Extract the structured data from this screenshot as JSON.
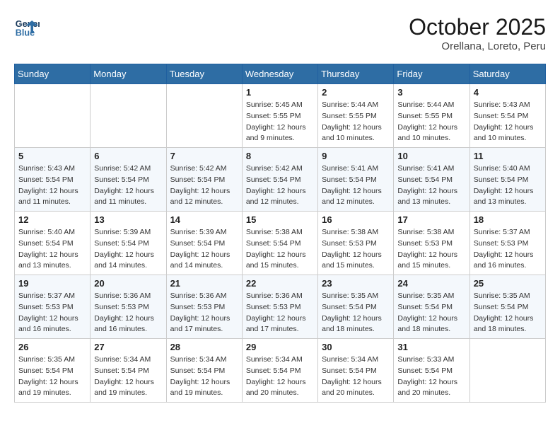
{
  "header": {
    "logo_line1": "General",
    "logo_line2": "Blue",
    "month": "October 2025",
    "location": "Orellana, Loreto, Peru"
  },
  "days_of_week": [
    "Sunday",
    "Monday",
    "Tuesday",
    "Wednesday",
    "Thursday",
    "Friday",
    "Saturday"
  ],
  "weeks": [
    [
      {
        "day": "",
        "info": ""
      },
      {
        "day": "",
        "info": ""
      },
      {
        "day": "",
        "info": ""
      },
      {
        "day": "1",
        "info": "Sunrise: 5:45 AM\nSunset: 5:55 PM\nDaylight: 12 hours\nand 9 minutes."
      },
      {
        "day": "2",
        "info": "Sunrise: 5:44 AM\nSunset: 5:55 PM\nDaylight: 12 hours\nand 10 minutes."
      },
      {
        "day": "3",
        "info": "Sunrise: 5:44 AM\nSunset: 5:55 PM\nDaylight: 12 hours\nand 10 minutes."
      },
      {
        "day": "4",
        "info": "Sunrise: 5:43 AM\nSunset: 5:54 PM\nDaylight: 12 hours\nand 10 minutes."
      }
    ],
    [
      {
        "day": "5",
        "info": "Sunrise: 5:43 AM\nSunset: 5:54 PM\nDaylight: 12 hours\nand 11 minutes."
      },
      {
        "day": "6",
        "info": "Sunrise: 5:42 AM\nSunset: 5:54 PM\nDaylight: 12 hours\nand 11 minutes."
      },
      {
        "day": "7",
        "info": "Sunrise: 5:42 AM\nSunset: 5:54 PM\nDaylight: 12 hours\nand 12 minutes."
      },
      {
        "day": "8",
        "info": "Sunrise: 5:42 AM\nSunset: 5:54 PM\nDaylight: 12 hours\nand 12 minutes."
      },
      {
        "day": "9",
        "info": "Sunrise: 5:41 AM\nSunset: 5:54 PM\nDaylight: 12 hours\nand 12 minutes."
      },
      {
        "day": "10",
        "info": "Sunrise: 5:41 AM\nSunset: 5:54 PM\nDaylight: 12 hours\nand 13 minutes."
      },
      {
        "day": "11",
        "info": "Sunrise: 5:40 AM\nSunset: 5:54 PM\nDaylight: 12 hours\nand 13 minutes."
      }
    ],
    [
      {
        "day": "12",
        "info": "Sunrise: 5:40 AM\nSunset: 5:54 PM\nDaylight: 12 hours\nand 13 minutes."
      },
      {
        "day": "13",
        "info": "Sunrise: 5:39 AM\nSunset: 5:54 PM\nDaylight: 12 hours\nand 14 minutes."
      },
      {
        "day": "14",
        "info": "Sunrise: 5:39 AM\nSunset: 5:54 PM\nDaylight: 12 hours\nand 14 minutes."
      },
      {
        "day": "15",
        "info": "Sunrise: 5:38 AM\nSunset: 5:54 PM\nDaylight: 12 hours\nand 15 minutes."
      },
      {
        "day": "16",
        "info": "Sunrise: 5:38 AM\nSunset: 5:53 PM\nDaylight: 12 hours\nand 15 minutes."
      },
      {
        "day": "17",
        "info": "Sunrise: 5:38 AM\nSunset: 5:53 PM\nDaylight: 12 hours\nand 15 minutes."
      },
      {
        "day": "18",
        "info": "Sunrise: 5:37 AM\nSunset: 5:53 PM\nDaylight: 12 hours\nand 16 minutes."
      }
    ],
    [
      {
        "day": "19",
        "info": "Sunrise: 5:37 AM\nSunset: 5:53 PM\nDaylight: 12 hours\nand 16 minutes."
      },
      {
        "day": "20",
        "info": "Sunrise: 5:36 AM\nSunset: 5:53 PM\nDaylight: 12 hours\nand 16 minutes."
      },
      {
        "day": "21",
        "info": "Sunrise: 5:36 AM\nSunset: 5:53 PM\nDaylight: 12 hours\nand 17 minutes."
      },
      {
        "day": "22",
        "info": "Sunrise: 5:36 AM\nSunset: 5:53 PM\nDaylight: 12 hours\nand 17 minutes."
      },
      {
        "day": "23",
        "info": "Sunrise: 5:35 AM\nSunset: 5:54 PM\nDaylight: 12 hours\nand 18 minutes."
      },
      {
        "day": "24",
        "info": "Sunrise: 5:35 AM\nSunset: 5:54 PM\nDaylight: 12 hours\nand 18 minutes."
      },
      {
        "day": "25",
        "info": "Sunrise: 5:35 AM\nSunset: 5:54 PM\nDaylight: 12 hours\nand 18 minutes."
      }
    ],
    [
      {
        "day": "26",
        "info": "Sunrise: 5:35 AM\nSunset: 5:54 PM\nDaylight: 12 hours\nand 19 minutes."
      },
      {
        "day": "27",
        "info": "Sunrise: 5:34 AM\nSunset: 5:54 PM\nDaylight: 12 hours\nand 19 minutes."
      },
      {
        "day": "28",
        "info": "Sunrise: 5:34 AM\nSunset: 5:54 PM\nDaylight: 12 hours\nand 19 minutes."
      },
      {
        "day": "29",
        "info": "Sunrise: 5:34 AM\nSunset: 5:54 PM\nDaylight: 12 hours\nand 20 minutes."
      },
      {
        "day": "30",
        "info": "Sunrise: 5:34 AM\nSunset: 5:54 PM\nDaylight: 12 hours\nand 20 minutes."
      },
      {
        "day": "31",
        "info": "Sunrise: 5:33 AM\nSunset: 5:54 PM\nDaylight: 12 hours\nand 20 minutes."
      },
      {
        "day": "",
        "info": ""
      }
    ]
  ]
}
